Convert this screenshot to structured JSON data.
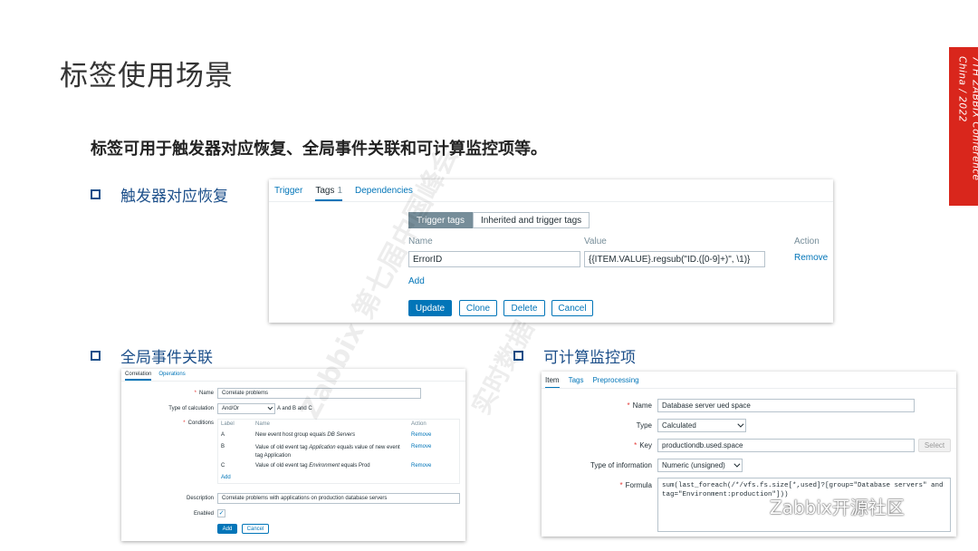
{
  "page": {
    "title": "标签使用场景",
    "subtitle": "标签可用于触发器对应恢复、全局事件关联和可计算监控项等。",
    "bullets": [
      "触发器对应恢复",
      "全局事件关联",
      "可计算监控项"
    ]
  },
  "banner": {
    "text": "7TH ZABBIX Conference China / 2022",
    "color": "#d9261c"
  },
  "watermark": {
    "line1": "Zabbix 第七届中国峰会",
    "line2": "实时数据"
  },
  "wechat": {
    "text": "Zabbix开源社区"
  },
  "trigger": {
    "tabs": [
      {
        "label": "Trigger"
      },
      {
        "label": "Tags",
        "count": "1"
      },
      {
        "label": "Dependencies"
      }
    ],
    "modes": [
      "Trigger tags",
      "Inherited and trigger tags"
    ],
    "col_name": "Name",
    "col_value": "Value",
    "col_action": "Action",
    "tag_name": "ErrorID",
    "tag_value": "{{ITEM.VALUE}.regsub(\"ID.([0-9]+)\", \\1)}",
    "remove": "Remove",
    "add": "Add",
    "buttons": [
      "Update",
      "Clone",
      "Delete",
      "Cancel"
    ]
  },
  "correlation": {
    "tabs": [
      "Correlation",
      "Operations"
    ],
    "name_label": "Name",
    "name_value": "Correlate problems",
    "calc_label": "Type of calculation",
    "calc_value": "And/Or",
    "calc_formula": "A and B and C",
    "cond_label": "Conditions",
    "cols": [
      "Label",
      "Name",
      "Action"
    ],
    "rows": [
      {
        "label": "A",
        "name": "New event host group equals ",
        "em": "DB Servers",
        "rest": "",
        "action": "Remove"
      },
      {
        "label": "B",
        "name": "Value of old event tag ",
        "em": "Application",
        "rest": " equals value of new event tag Application",
        "action": "Remove"
      },
      {
        "label": "C",
        "name": "Value of old event tag ",
        "em": "Environment",
        "rest": " equals Prod",
        "action": "Remove"
      }
    ],
    "add": "Add",
    "desc_label": "Description",
    "desc_value": "Correlate problems with applications on production database servers",
    "enabled_label": "Enabled",
    "buttons": [
      "Add",
      "Cancel"
    ]
  },
  "item": {
    "tabs": [
      "Item",
      "Tags",
      "Preprocessing"
    ],
    "name_label": "Name",
    "name_value": "Database server ued space",
    "type_label": "Type",
    "type_value": "Calculated",
    "key_label": "Key",
    "key_value": "productiondb.used.space",
    "select": "Select",
    "info_label": "Type of information",
    "info_value": "Numeric (unsigned)",
    "formula_label": "Formula",
    "formula_line1": "sum(last_foreach(/*/vfs.fs.size[*,used]?[group=\"Database servers\" and",
    "formula_line2": "tag=\"Environment:production\"]))"
  }
}
